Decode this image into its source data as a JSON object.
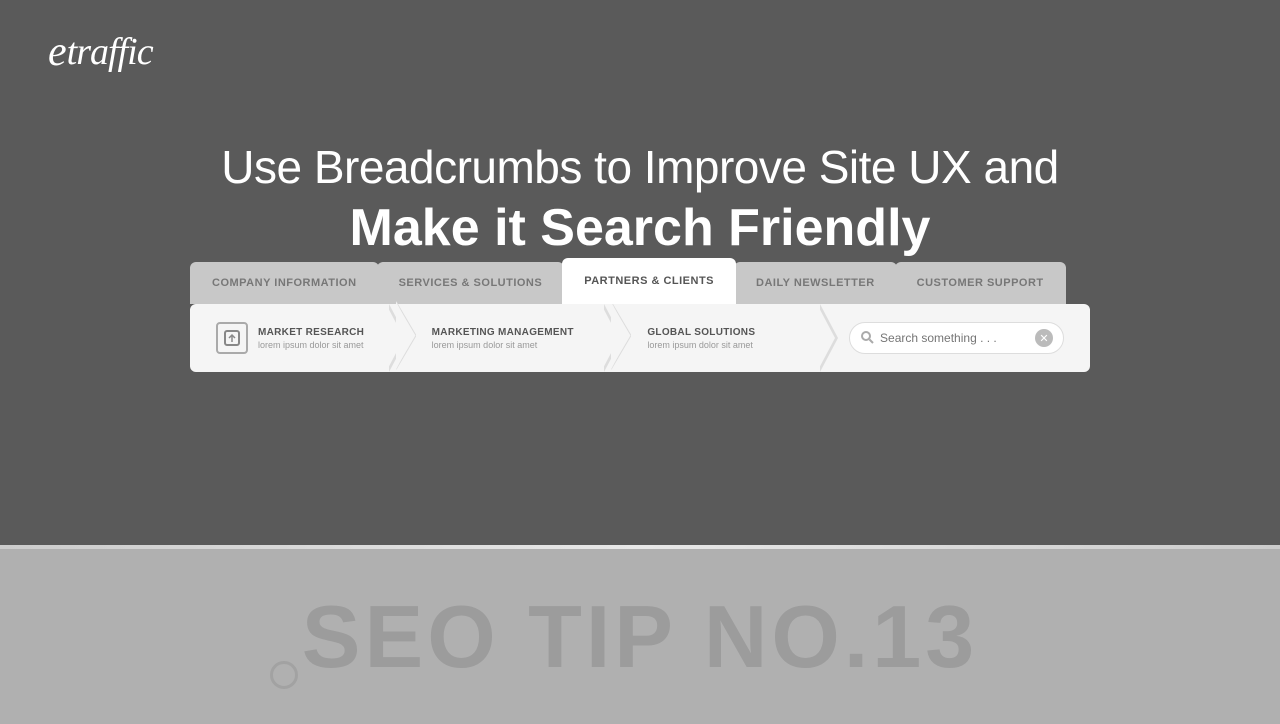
{
  "logo": {
    "text": "etraffic"
  },
  "heading": {
    "line1": "Use Breadcrumbs to Improve Site UX and",
    "line2": "Make it Search Friendly"
  },
  "nav_tabs": [
    {
      "id": "company-info",
      "label": "COMPANY INFORMATION",
      "active": false
    },
    {
      "id": "services-solutions",
      "label": "SERVICES & SOLUTIONS",
      "active": false
    },
    {
      "id": "partners-clients",
      "label": "PARTNERS & CLIENTS",
      "active": true
    },
    {
      "id": "daily-newsletter",
      "label": "DAILY NEWSLETTER",
      "active": false
    },
    {
      "id": "customer-support",
      "label": "CUSTOMER SUPPORT",
      "active": false
    }
  ],
  "breadcrumbs": [
    {
      "id": "market-research",
      "title": "MARKET RESEARCH",
      "subtitle": "lorem ipsum dolor sit amet",
      "icon": "→"
    },
    {
      "id": "marketing-management",
      "title": "MARKETING MANAGEMENT",
      "subtitle": "lorem ipsum dolor sit amet",
      "icon": ""
    },
    {
      "id": "global-solutions",
      "title": "GLOBAL SOLUTIONS",
      "subtitle": "lorem ipsum dolor sit amet",
      "icon": ""
    }
  ],
  "search": {
    "placeholder": "Search something . . ."
  },
  "seo_tip": {
    "text": "SEO TIP NO.13"
  },
  "colors": {
    "top_bg": "#5a5a5a",
    "bottom_bg": "#b0b0b0",
    "active_tab_bg": "#ffffff",
    "inactive_tab_bg": "#c8c8c8"
  }
}
